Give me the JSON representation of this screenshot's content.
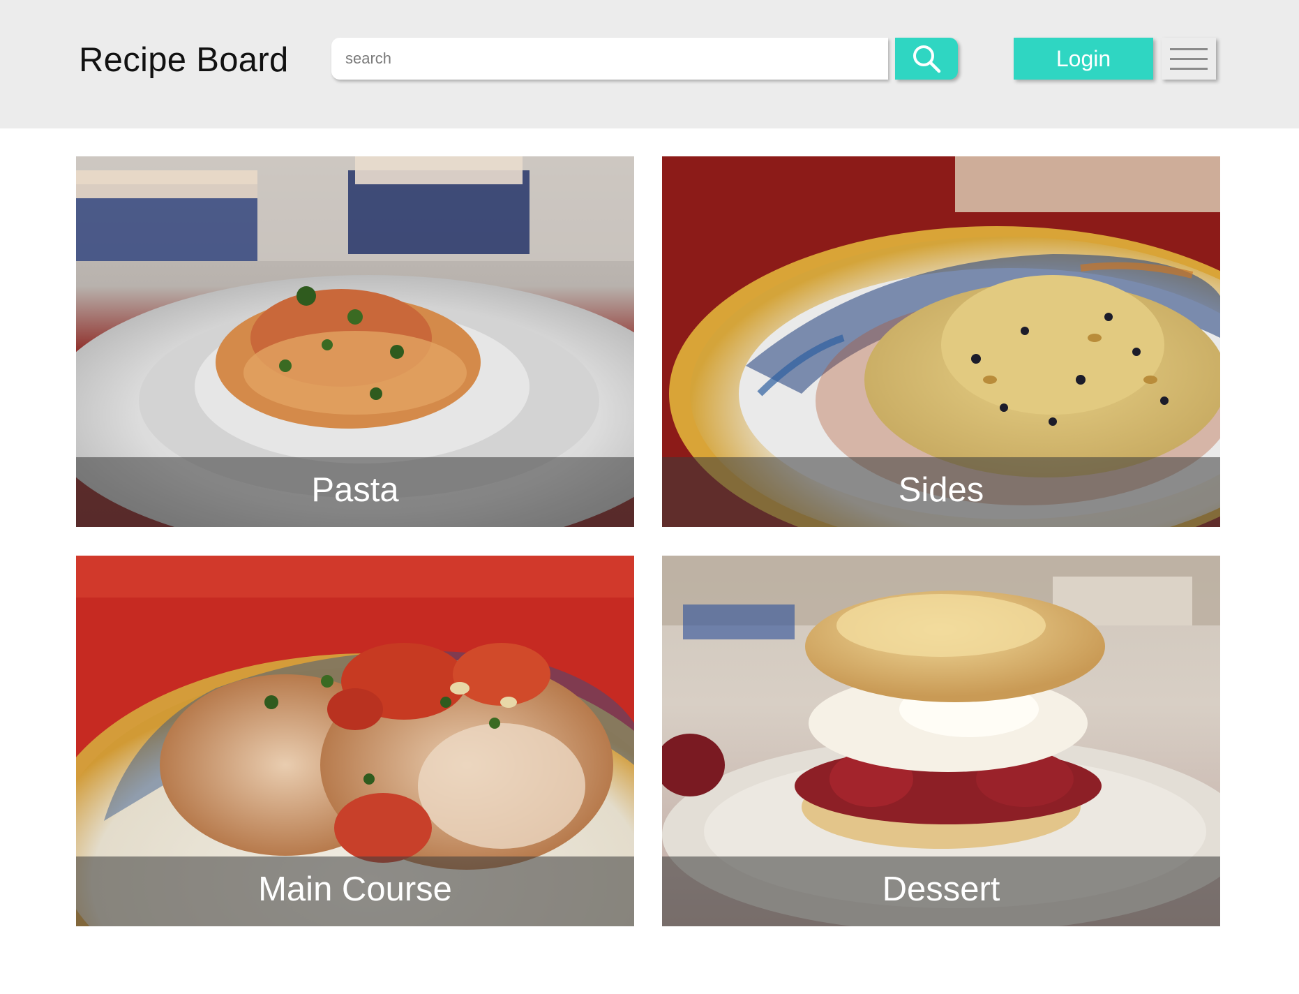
{
  "app": {
    "title": "Recipe Board",
    "accent_color": "#2fd6c2"
  },
  "search": {
    "placeholder": "search",
    "value": "",
    "button_icon": "search-icon"
  },
  "header": {
    "login_label": "Login",
    "menu_icon": "hamburger-menu-icon"
  },
  "categories": [
    {
      "label": "Pasta",
      "image": "pasta-photo"
    },
    {
      "label": "Sides",
      "image": "couscous-side-photo"
    },
    {
      "label": "Main Course",
      "image": "chicken-main-course-photo"
    },
    {
      "label": "Dessert",
      "image": "strawberry-shortcake-photo"
    }
  ]
}
